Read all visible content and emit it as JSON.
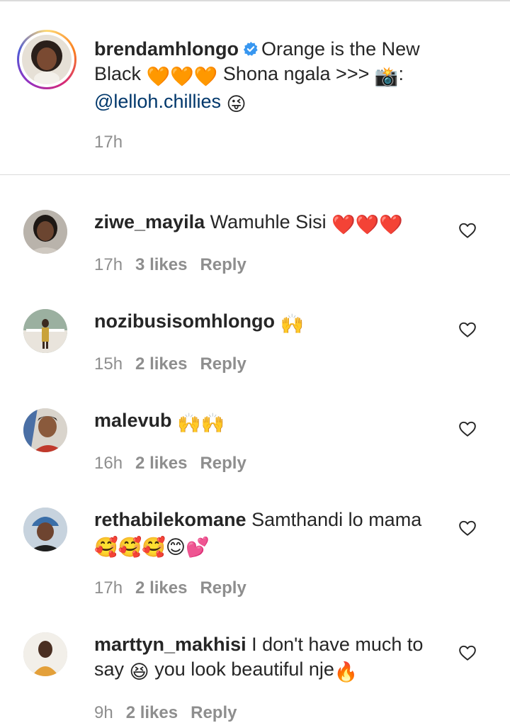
{
  "caption": {
    "username": "brendamhlongo",
    "text_part1": "Orange is the New Black",
    "hearts_emoji": "🧡🧡🧡",
    "text_part2": "Shona ngala >>>",
    "camera_emoji": "📸",
    "colon": ":",
    "mention": "@lelloh.chillies",
    "wink_emoji": "😜",
    "time": "17h",
    "verified_icon": "verified-badge-icon"
  },
  "comments": [
    {
      "username": "ziwe_mayila",
      "text": "Wamuhle Sisi",
      "emoji": "❤️❤️❤️",
      "time": "17h",
      "likes": "3 likes",
      "reply": "Reply"
    },
    {
      "username": "nozibusisomhlongo",
      "text": "",
      "emoji": "🙌",
      "time": "15h",
      "likes": "2 likes",
      "reply": "Reply"
    },
    {
      "username": "malevub",
      "text": "",
      "emoji": "🙌🙌",
      "time": "16h",
      "likes": "2 likes",
      "reply": "Reply"
    },
    {
      "username": "rethabilekomane",
      "text": "Samthandi lo mama",
      "emoji": "🥰🥰🥰😊💕",
      "time": "17h",
      "likes": "2 likes",
      "reply": "Reply"
    },
    {
      "username": "marttyn_makhisi",
      "text": "I don't have much to say",
      "emoji_mid": "😆",
      "text2": "you look beautiful nje",
      "emoji": "🔥",
      "time": "9h",
      "likes": "2 likes",
      "reply": "Reply"
    }
  ],
  "colors": {
    "text": "#262626",
    "meta": "#8e8e8e",
    "mention": "#00376b",
    "verified": "#3897f0",
    "divider": "#dbdbdb"
  }
}
